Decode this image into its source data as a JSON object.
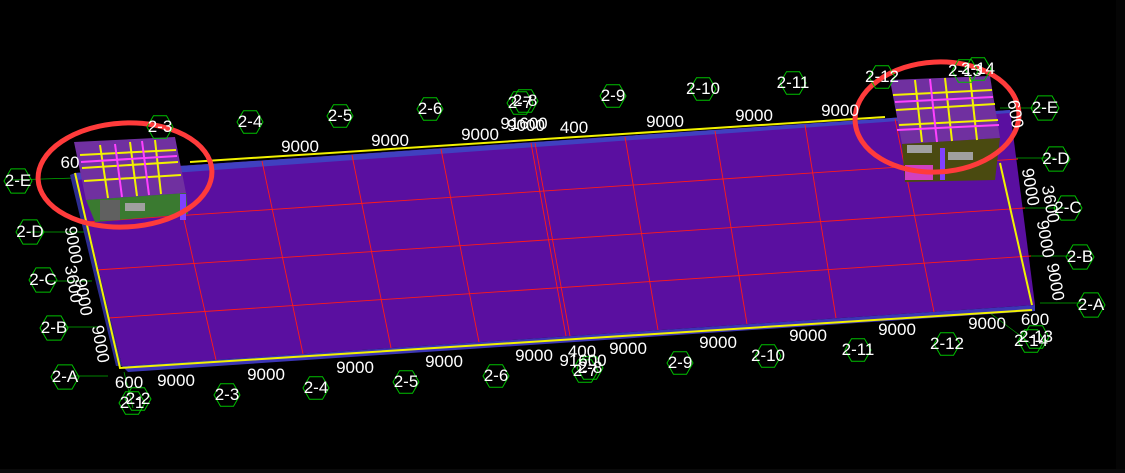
{
  "colors": {
    "background": "#000000",
    "slab": "#5a0fa0",
    "slab_edge": "#3a3ab8",
    "beam_red": "#ff1a1a",
    "outline_yellow": "#f2f200",
    "axis_green": "#00c000",
    "highlight_ring": "#ff3b3b"
  },
  "axes_bottom": [
    "2-1",
    "2-2",
    "2-3",
    "2-4",
    "2-5",
    "2-6",
    "2-7",
    "2-8",
    "2-9",
    "2-10",
    "2-11",
    "2-12",
    "2-13",
    "2-14"
  ],
  "axes_top": [
    "2-3",
    "2-4",
    "2-5",
    "2-6",
    "2-7",
    "2-8",
    "2-9",
    "2-10",
    "2-11",
    "2-12",
    "2-13",
    "2-14"
  ],
  "axes_left": [
    "2-A",
    "2-B",
    "2-C",
    "2-D",
    "2-E"
  ],
  "axes_right": [
    "2-A",
    "2-B",
    "2-C",
    "2-D",
    "2-E"
  ],
  "dims_bottom": [
    "600",
    "9000",
    "9000",
    "9000",
    "9000",
    "9000",
    "400",
    "9000",
    "9000",
    "9000",
    "9000",
    "9000",
    "600"
  ],
  "dims_bottom_total": "91600",
  "dims_top": [
    "9000",
    "9000",
    "9000",
    "9000",
    "400",
    "9000",
    "9000",
    "9000"
  ],
  "dims_top_total": "91600",
  "dims_left": [
    "9000",
    "3600",
    "9000",
    "9000",
    "60"
  ],
  "dims_right": [
    "9000",
    "3600",
    "9000",
    "9000",
    "600"
  ],
  "highlighted_regions": [
    "left-structure-highlight",
    "right-structure-highlight"
  ]
}
